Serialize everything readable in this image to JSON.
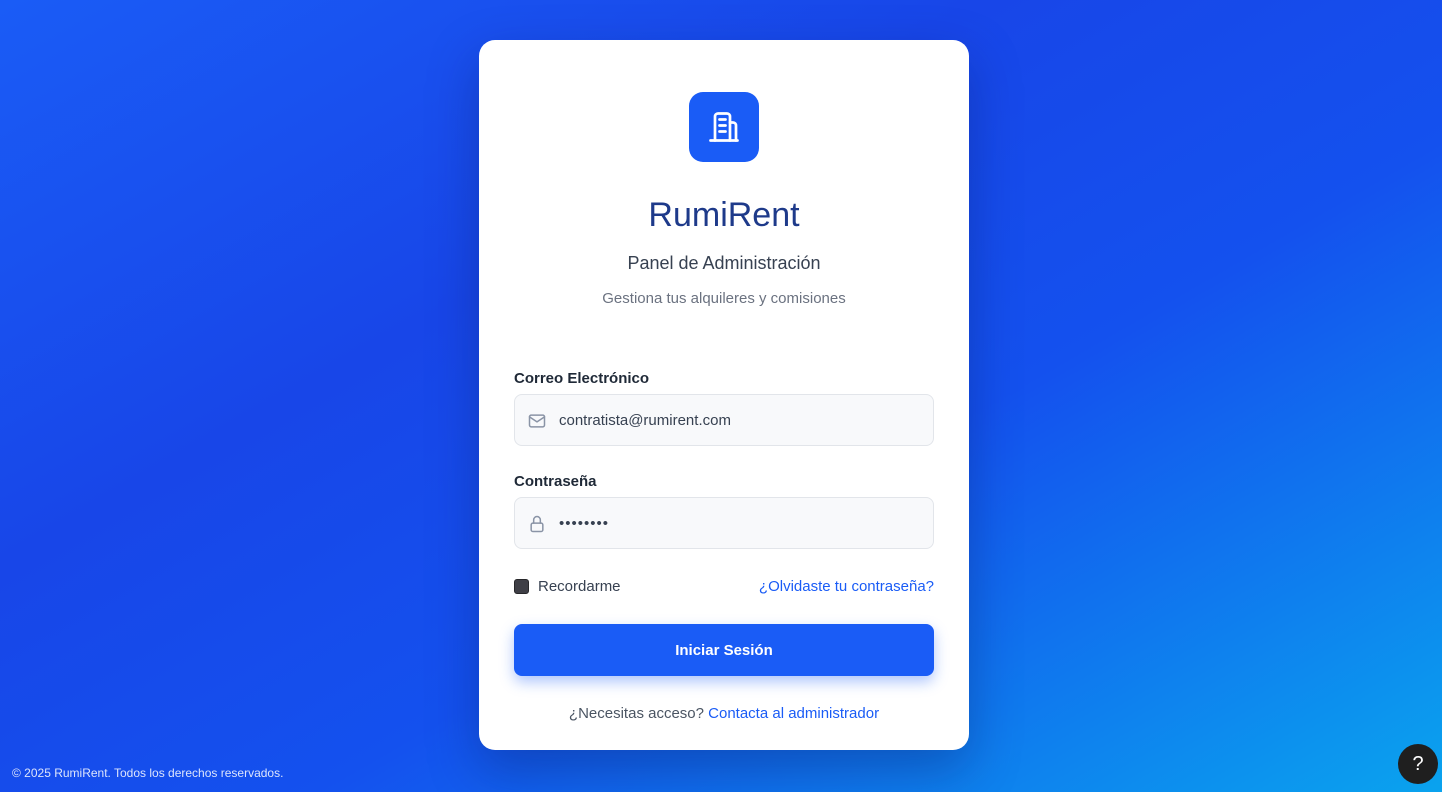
{
  "brand": {
    "name": "RumiRent",
    "subtitle": "Panel de Administración",
    "tagline": "Gestiona tus alquileres y comisiones",
    "logo_icon": "building-icon"
  },
  "form": {
    "email_label": "Correo Electrónico",
    "email_value": "contratista@rumirent.com",
    "email_icon": "mail-icon",
    "password_label": "Contraseña",
    "password_value": "••••••••",
    "password_icon": "lock-icon",
    "remember_label": "Recordarme",
    "remember_checked": false,
    "forgot_link": "¿Olvidaste tu contraseña?",
    "submit_label": "Iniciar Sesión"
  },
  "access": {
    "prompt": "¿Necesitas acceso?",
    "link": "Contacta al administrador"
  },
  "footer": {
    "copyright": "© 2025 RumiRent. Todos los derechos reservados."
  },
  "help": {
    "label": "?"
  },
  "colors": {
    "primary": "#1a5cf6",
    "brand_text": "#1e3a8a",
    "background_start": "#1a5cf6",
    "background_end": "#0aa3ee"
  }
}
